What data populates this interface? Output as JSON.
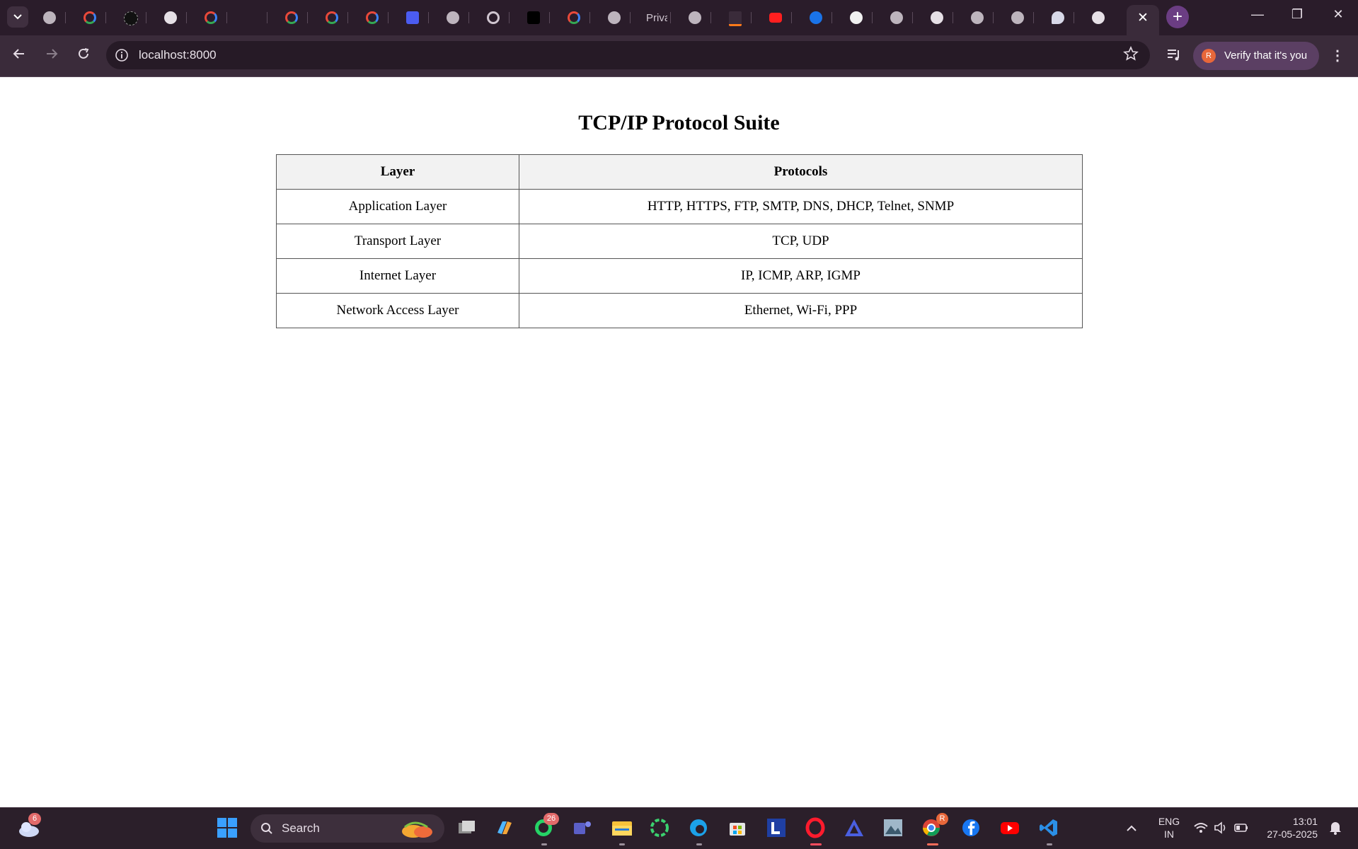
{
  "browser": {
    "tab_text": "Priva",
    "tab_icons": [
      "globe-icon",
      "google-icon",
      "stackademic-icon",
      "openai-icon",
      "google-icon",
      "blank-icon",
      "google-icon",
      "google-icon",
      "google-icon",
      "code-icon",
      "globe-icon",
      "chrome-icon",
      "stackademic-icon",
      "google-icon",
      "globe-icon",
      "text-tab",
      "globe-icon",
      "invision-icon",
      "youtube-icon",
      "c-icon",
      "github-icon",
      "globe-icon",
      "openai-icon",
      "globe-icon",
      "globe-icon",
      "chat-icon",
      "openai-icon"
    ],
    "active_tab_close": "✕",
    "new_tab": "+",
    "window_controls": [
      "—",
      "❐",
      "✕"
    ],
    "url": "localhost:8000",
    "verify_label": "Verify that it's you",
    "avatar_initial": "R"
  },
  "page": {
    "title": "TCP/IP Protocol Suite",
    "table": {
      "headers": [
        "Layer",
        "Protocols"
      ],
      "rows": [
        [
          "Application Layer",
          "HTTP, HTTPS, FTP, SMTP, DNS, DHCP, Telnet, SNMP"
        ],
        [
          "Transport Layer",
          "TCP, UDP"
        ],
        [
          "Internet Layer",
          "IP, ICMP, ARP, IGMP"
        ],
        [
          "Network Access Layer",
          "Ethernet, Wi-Fi, PPP"
        ]
      ]
    }
  },
  "taskbar": {
    "weather_badge": "6",
    "search_label": "Search",
    "whatsapp_badge": "26",
    "chrome_badge": "R",
    "lang_line1": "ENG",
    "lang_line2": "IN",
    "time": "13:01",
    "date": "27-05-2025"
  },
  "colors": {
    "tabstrip": "#2a1c2a",
    "toolbar": "#3a2b3a",
    "accent": "#6b3d83",
    "taskbar": "#2b1f2a"
  }
}
